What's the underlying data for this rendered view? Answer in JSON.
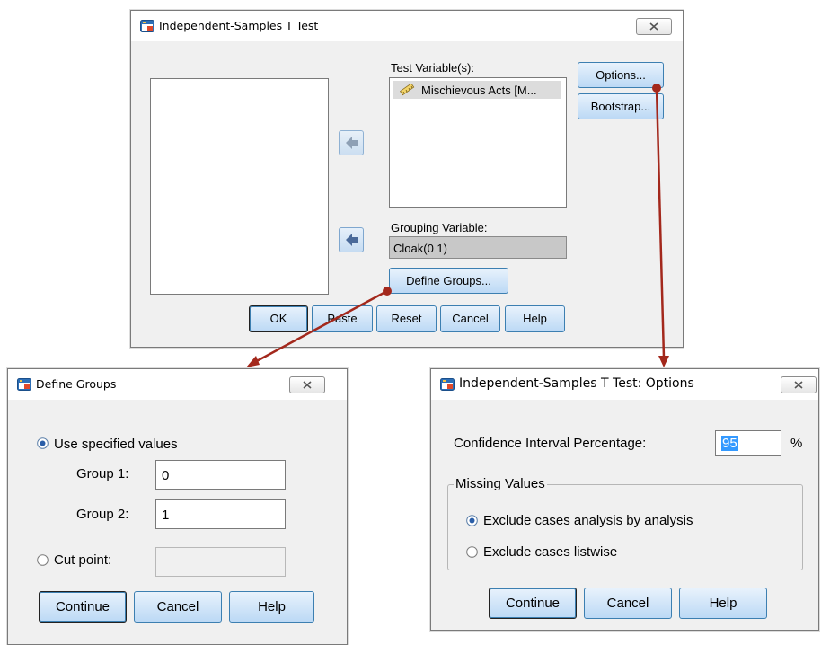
{
  "main_dialog": {
    "title": "Independent-Samples T Test",
    "test_variables_label": "Test Variable(s):",
    "test_variable_item": "Mischievous Acts [M...",
    "grouping_variable_label": "Grouping Variable:",
    "grouping_variable_value": "Cloak(0 1)",
    "define_groups_button": "Define Groups...",
    "options_button": "Options...",
    "bootstrap_button": "Bootstrap...",
    "buttons": {
      "ok": "OK",
      "paste": "Paste",
      "reset": "Reset",
      "cancel": "Cancel",
      "help": "Help"
    }
  },
  "define_groups_dialog": {
    "title": "Define Groups",
    "use_specified_values_label": "Use specified values",
    "use_specified_values_selected": true,
    "group1_label": "Group 1:",
    "group1_value": "0",
    "group2_label": "Group 2:",
    "group2_value": "1",
    "cut_point_label": "Cut point:",
    "cut_point_value": "",
    "buttons": {
      "continue": "Continue",
      "cancel": "Cancel",
      "help": "Help"
    }
  },
  "options_dialog": {
    "title": "Independent-Samples T Test: Options",
    "ci_label": "Confidence Interval Percentage:",
    "ci_value": "95",
    "ci_unit": "%",
    "missing_values_title": "Missing Values",
    "exclude_analysis_label": "Exclude cases analysis by analysis",
    "exclude_analysis_selected": true,
    "exclude_listwise_label": "Exclude cases listwise",
    "buttons": {
      "continue": "Continue",
      "cancel": "Cancel",
      "help": "Help"
    }
  },
  "colors": {
    "connector": "#a3281c",
    "accent_button": "#bcd9f5",
    "selection": "#3399ff"
  },
  "icons": [
    "spss-dialog-icon",
    "close-icon",
    "ruler-scale-icon",
    "arrow-left-icon"
  ]
}
